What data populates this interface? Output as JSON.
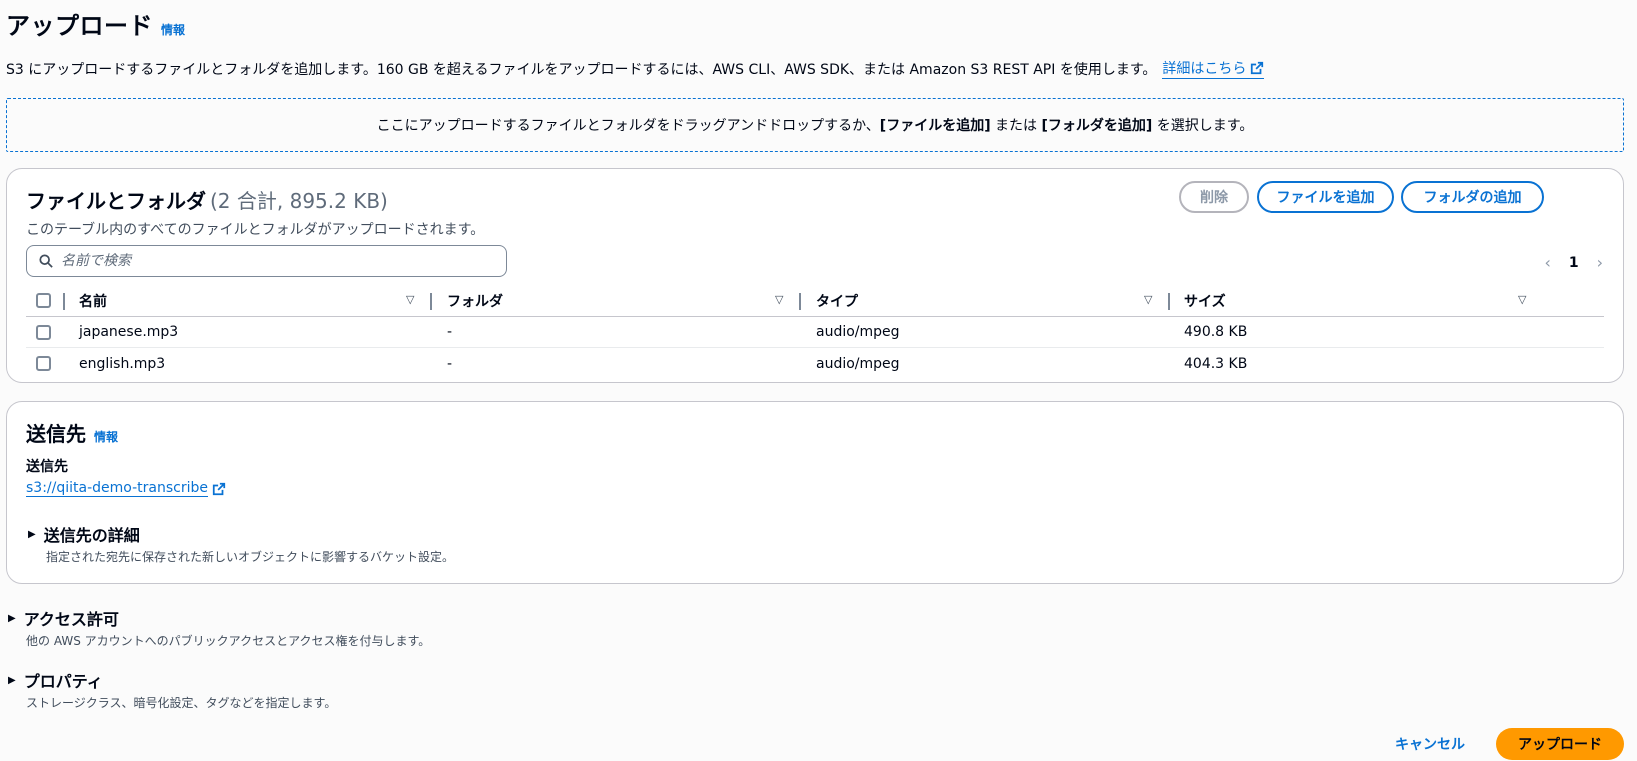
{
  "header": {
    "title": "アップロード",
    "info": "情報",
    "description": "S3 にアップロードするファイルとフォルダを追加します。160 GB を超えるファイルをアップロードするには、AWS CLI、AWS SDK、または Amazon S3 REST API を使用します。",
    "details_link": "詳細はこちら"
  },
  "dropzone": {
    "text_before": "ここにアップロードするファイルとフォルダをドラッグアンドドロップするか、",
    "add_files": "[ファイルを追加]",
    "text_middle": " または ",
    "add_folder": "[フォルダを追加]",
    "text_after": " を選択します。"
  },
  "files": {
    "title": "ファイルとフォルダ",
    "count": "(2 合計, 895.2 KB)",
    "subtitle": "このテーブル内のすべてのファイルとフォルダがアップロードされます。",
    "delete_label": "削除",
    "add_files_label": "ファイルを追加",
    "add_folder_label": "フォルダの追加",
    "search_placeholder": "名前で検索",
    "page": "1",
    "columns": [
      "名前",
      "フォルダ",
      "タイプ",
      "サイズ"
    ],
    "rows": [
      {
        "name": "japanese.mp3",
        "folder": "-",
        "type": "audio/mpeg",
        "size": "490.8 KB"
      },
      {
        "name": "english.mp3",
        "folder": "-",
        "type": "audio/mpeg",
        "size": "404.3 KB"
      }
    ]
  },
  "destination": {
    "title": "送信先",
    "info": "情報",
    "label": "送信先",
    "link": "s3://qiita-demo-transcribe",
    "details_title": "送信先の詳細",
    "details_desc": "指定された宛先に保存された新しいオブジェクトに影響するバケット設定。"
  },
  "access": {
    "title": "アクセス許可",
    "desc": "他の AWS アカウントへのパブリックアクセスとアクセス権を付与します。"
  },
  "properties": {
    "title": "プロパティ",
    "desc": "ストレージクラス、暗号化設定、タグなどを指定します。"
  },
  "footer": {
    "cancel_label": "キャンセル",
    "upload_label": "アップロード"
  },
  "colors": {
    "link": "#0972d3",
    "primary_button": "#ff9900",
    "border": "#c6c6cd"
  }
}
